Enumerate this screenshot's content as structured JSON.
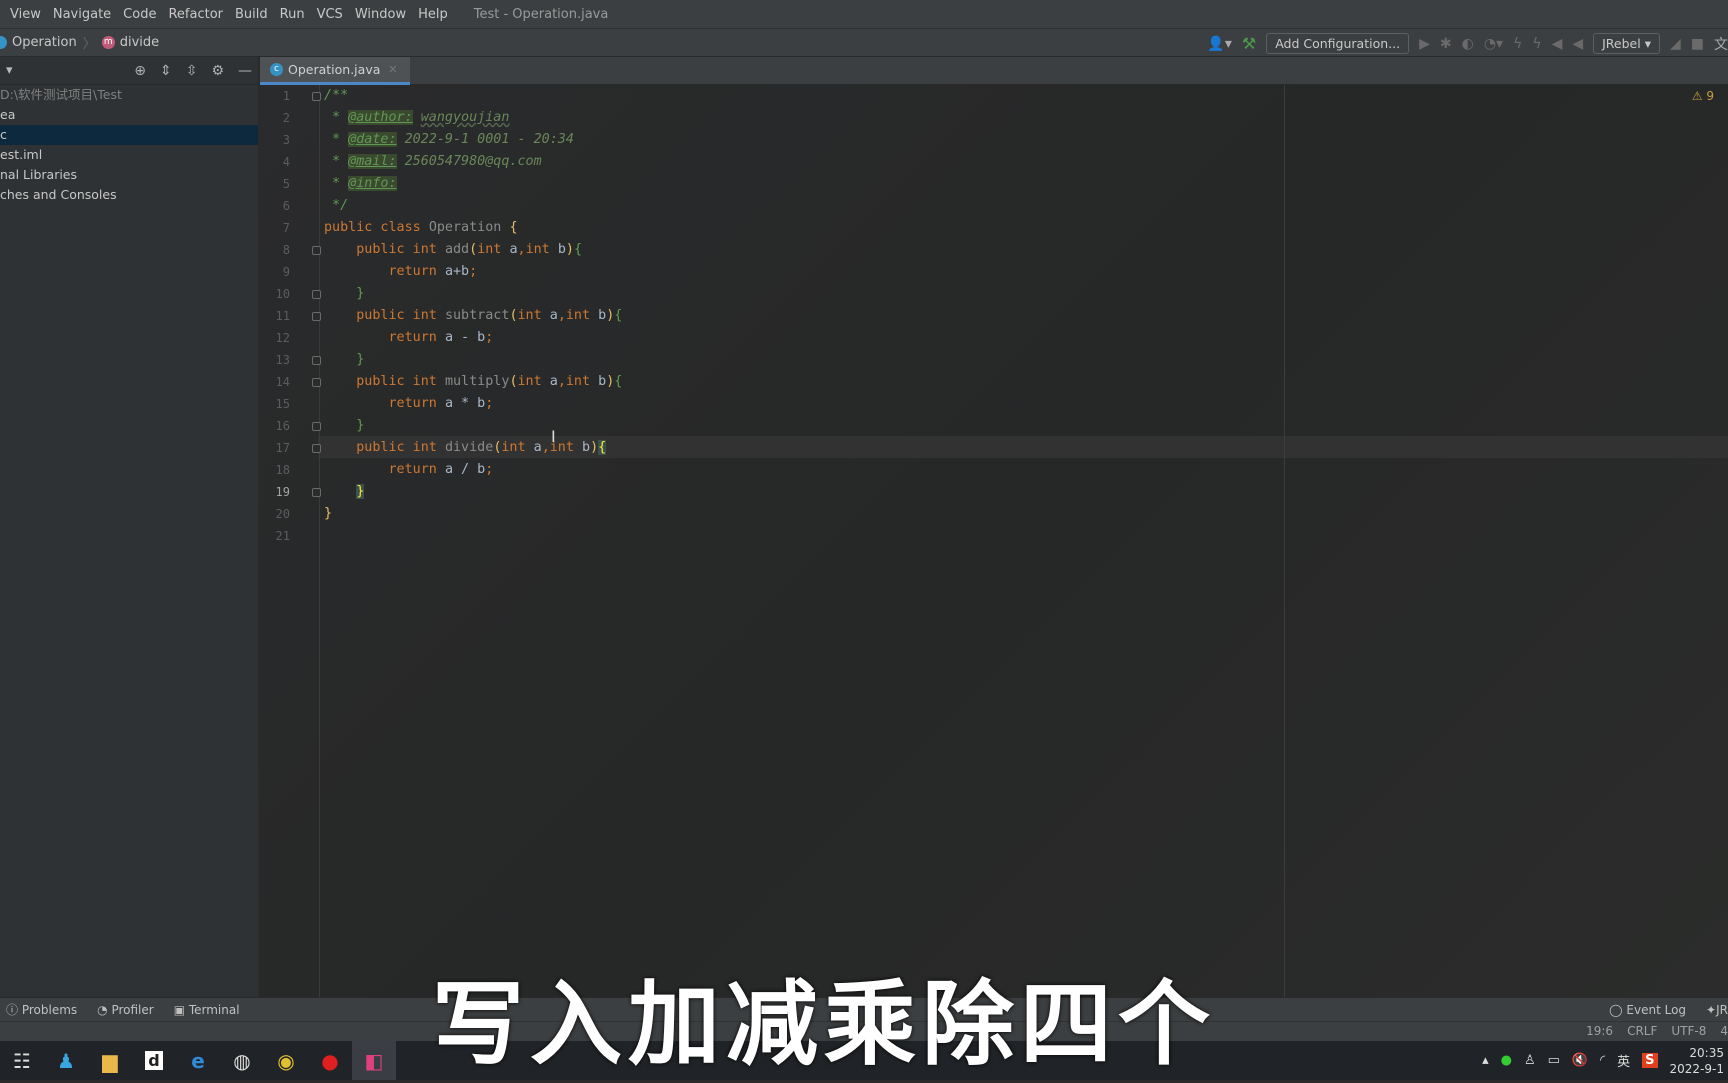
{
  "menu": {
    "items": [
      "View",
      "Navigate",
      "Code",
      "Refactor",
      "Build",
      "Run",
      "VCS",
      "Window",
      "Help"
    ],
    "window_title": "Test - Operation.java"
  },
  "breadcrumb": {
    "class": "Operation",
    "method": "divide"
  },
  "toolbar": {
    "add_config": "Add Configuration...",
    "jrebel": "JRebel"
  },
  "project": {
    "items": [
      {
        "label": "D:\\软件测试项目\\Test",
        "dim": true
      },
      {
        "label": "ea"
      },
      {
        "label": "c",
        "selected": true
      },
      {
        "label": "est.iml"
      },
      {
        "label": "nal Libraries"
      },
      {
        "label": "ches and Consoles"
      }
    ]
  },
  "tab": {
    "label": "Operation.java"
  },
  "editor": {
    "warnings": "9",
    "current_line": 19,
    "lines": [
      [
        [
          "cm",
          "/**"
        ]
      ],
      [
        [
          "cm",
          " * "
        ],
        [
          "tag",
          "@author:"
        ],
        [
          "cm",
          " "
        ],
        [
          "val und",
          "wangyoujian"
        ]
      ],
      [
        [
          "cm",
          " * "
        ],
        [
          "tag",
          "@date:"
        ],
        [
          "val",
          " 2022-9-1 0001 - 20:34"
        ]
      ],
      [
        [
          "cm",
          " * "
        ],
        [
          "tag",
          "@mail:"
        ],
        [
          "val",
          " 2560547980@qq.com"
        ]
      ],
      [
        [
          "cm",
          " * "
        ],
        [
          "tag",
          "@info:"
        ]
      ],
      [
        [
          "cm",
          " */"
        ]
      ],
      [
        [
          "kw",
          "public class "
        ],
        [
          "fn",
          "Operation "
        ],
        [
          "br",
          "{"
        ]
      ],
      [
        [
          "kw",
          "    public int "
        ],
        [
          "fn",
          "add"
        ],
        [
          "br",
          "("
        ],
        [
          "kw",
          "int "
        ],
        [
          "id",
          "a"
        ],
        [
          "kw",
          ","
        ],
        [
          "kw",
          "int "
        ],
        [
          "id",
          "b"
        ],
        [
          "br",
          ")"
        ],
        [
          "gb",
          "{"
        ]
      ],
      [
        [
          "kw",
          "        return "
        ],
        [
          "id",
          "a+b"
        ],
        [
          "kw",
          ";"
        ]
      ],
      [
        [
          "gb",
          "    }"
        ]
      ],
      [
        [
          "kw",
          "    public int "
        ],
        [
          "fn",
          "subtract"
        ],
        [
          "br",
          "("
        ],
        [
          "kw",
          "int "
        ],
        [
          "id",
          "a"
        ],
        [
          "kw",
          ","
        ],
        [
          "kw",
          "int "
        ],
        [
          "id",
          "b"
        ],
        [
          "br",
          ")"
        ],
        [
          "gb",
          "{"
        ]
      ],
      [
        [
          "kw",
          "        return "
        ],
        [
          "id",
          "a - b"
        ],
        [
          "kw",
          ";"
        ]
      ],
      [
        [
          "gb",
          "    }"
        ]
      ],
      [
        [
          "kw",
          "    public int "
        ],
        [
          "fn",
          "multiply"
        ],
        [
          "br",
          "("
        ],
        [
          "kw",
          "int "
        ],
        [
          "id",
          "a"
        ],
        [
          "kw",
          ","
        ],
        [
          "kw",
          "int "
        ],
        [
          "id",
          "b"
        ],
        [
          "br",
          ")"
        ],
        [
          "gb",
          "{"
        ]
      ],
      [
        [
          "kw",
          "        return "
        ],
        [
          "id",
          "a * b"
        ],
        [
          "kw",
          ";"
        ]
      ],
      [
        [
          "gb",
          "    }"
        ]
      ],
      [
        [
          "kw",
          "    public int "
        ],
        [
          "fn",
          "divide"
        ],
        [
          "br",
          "("
        ],
        [
          "kw",
          "int "
        ],
        [
          "id",
          "a"
        ],
        [
          "kw",
          ","
        ],
        [
          "kw",
          "int "
        ],
        [
          "id",
          "b"
        ],
        [
          "br",
          ")"
        ],
        [
          "hl",
          "{"
        ]
      ],
      [
        [
          "kw",
          "        return "
        ],
        [
          "id",
          "a / b"
        ],
        [
          "kw",
          ";"
        ]
      ],
      [
        [
          "id",
          "    "
        ],
        [
          "hl",
          "}"
        ]
      ],
      [
        [
          "br",
          "}"
        ]
      ],
      []
    ]
  },
  "bottom_tools": {
    "problems": "Problems",
    "profiler": "Profiler",
    "terminal": "Terminal",
    "event_log": "Event Log",
    "jr": "JR"
  },
  "status": {
    "position": "19:6",
    "line_sep": "CRLF",
    "encoding": "UTF-8",
    "indent": "4"
  },
  "subtitle": "写入加减乘除四个",
  "tray": {
    "ime": "英",
    "time": "20:35",
    "date": "2022-9-1"
  }
}
